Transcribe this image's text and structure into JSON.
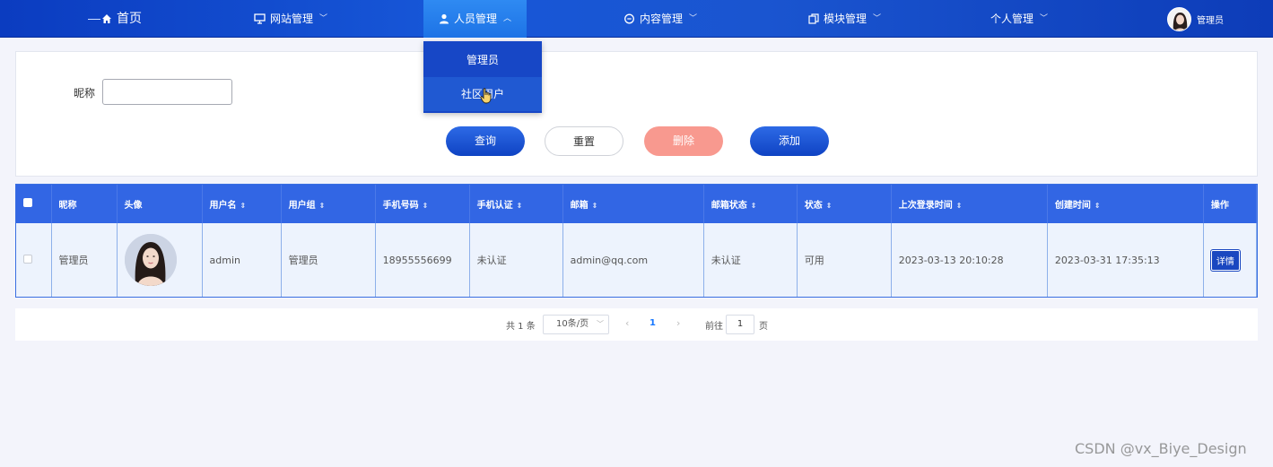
{
  "nav": {
    "home": "首页",
    "items": [
      {
        "label": "网站管理",
        "icon": "monitor-icon"
      },
      {
        "label": "人员管理",
        "icon": "person-icon"
      },
      {
        "label": "内容管理",
        "icon": "chat-icon"
      },
      {
        "label": "模块管理",
        "icon": "copy-icon"
      },
      {
        "label": "个人管理",
        "icon": ""
      }
    ],
    "user": "管理员"
  },
  "dropdown": {
    "items": [
      "管理员",
      "社区用户"
    ]
  },
  "search": {
    "nickname_label": "昵称",
    "nickname_value": "",
    "buttons": {
      "query": "查询",
      "reset": "重置",
      "delete": "删除",
      "add": "添加"
    }
  },
  "table": {
    "headers": [
      "昵称",
      "头像",
      "用户名",
      "用户组",
      "手机号码",
      "手机认证",
      "邮箱",
      "邮箱状态",
      "状态",
      "上次登录时间",
      "创建时间",
      "操作"
    ],
    "rows": [
      {
        "nickname": "管理员",
        "username": "admin",
        "group": "管理员",
        "phone": "18955556699",
        "phone_verified": "未认证",
        "email": "admin@qq.com",
        "email_status": "未认证",
        "status": "可用",
        "last_login": "2023-03-13 20:10:28",
        "created": "2023-03-31 17:35:13",
        "action": "详情"
      }
    ]
  },
  "pagination": {
    "total": "共 1 条",
    "page_size": "10条/页",
    "current": "1",
    "goto_label": "前往",
    "goto_value": "1",
    "page_suffix": "页"
  },
  "watermark": "CSDN @vx_Biye_Design",
  "colors": {
    "nav_bg": "#1757d8",
    "primary": "#1a47c0",
    "table_header": "#3266e4",
    "delete": "#f8998f"
  }
}
